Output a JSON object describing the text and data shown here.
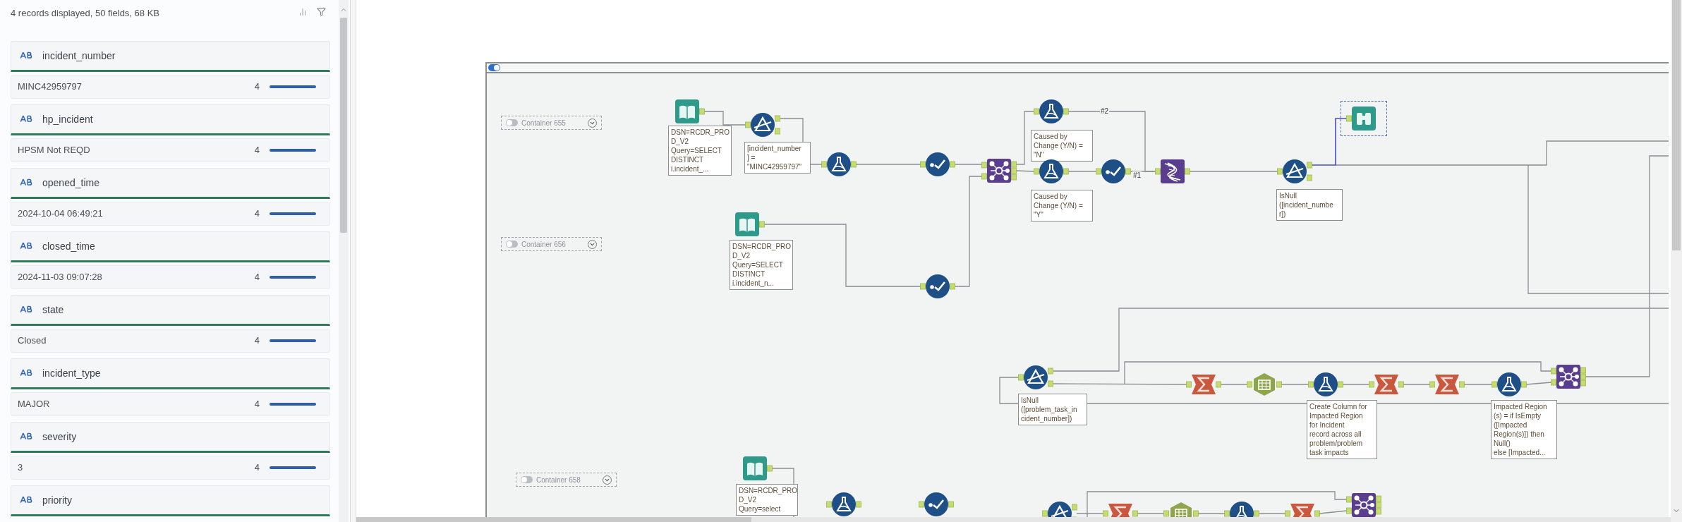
{
  "results_panel": {
    "summary": "4 records displayed, 50 fields, 68 KB",
    "fields": [
      {
        "name": "incident_number",
        "value": "MINC42959797",
        "count": "4",
        "level": 1
      },
      {
        "name": "hp_incident",
        "value": "HPSM Not REQD",
        "count": "4",
        "level": 1
      },
      {
        "name": "opened_time",
        "value": "2024-10-04 06:49:21",
        "count": "4",
        "level": 1
      },
      {
        "name": "closed_time",
        "value": "2024-11-03 09:07:28",
        "count": "4",
        "level": 1
      },
      {
        "name": "state",
        "value": "Closed",
        "count": "4",
        "level": 1
      },
      {
        "name": "incident_type",
        "value": "MAJOR",
        "count": "4",
        "level": 1
      },
      {
        "name": "severity",
        "value": "3",
        "count": "4",
        "level": 1
      },
      {
        "name": "priority"
      }
    ]
  },
  "canvas": {
    "main_container": {
      "on": true
    },
    "containers": [
      {
        "label": "Container 655",
        "on": false
      },
      {
        "label": "Container 656",
        "on": false
      },
      {
        "label": "Container 658",
        "on": false
      }
    ],
    "tools": [
      {
        "kind": "input",
        "selected": false,
        "annotation": [
          "DSN=RCDR_PRO",
          "D_V2",
          "Query=SELECT",
          "DISTINCT",
          "i.incident_..."
        ]
      },
      {
        "kind": "filter",
        "selected": false,
        "annotation": [
          "[incident_number",
          "] =",
          "\"MINC42959797\""
        ]
      },
      {
        "kind": "formula",
        "selected": false
      },
      {
        "kind": "select",
        "selected": false
      },
      {
        "kind": "input",
        "selected": false,
        "annotation": [
          "DSN=RCDR_PRO",
          "D_V2",
          "Query=SELECT",
          "DISTINCT",
          "i.incident_n..."
        ]
      },
      {
        "kind": "select",
        "selected": false
      },
      {
        "kind": "join",
        "selected": false
      },
      {
        "kind": "formula",
        "selected": false,
        "annotation": [
          "Caused by",
          "Change (Y/N) =",
          "\"N\""
        ]
      },
      {
        "kind": "formula",
        "selected": false,
        "annotation": [
          "Caused by",
          "Change (Y/N) =",
          "\"Y\""
        ]
      },
      {
        "kind": "select",
        "selected": false
      },
      {
        "kind": "dna",
        "selected": false
      },
      {
        "kind": "filter",
        "selected": false,
        "annotation": [
          "IsNull",
          "([incident_numbe",
          "r])"
        ]
      },
      {
        "kind": "browse",
        "selected": true
      },
      {
        "kind": "filter",
        "selected": false,
        "annotation": [
          "IsNull",
          "([problem_task_in",
          "cident_number])"
        ]
      },
      {
        "kind": "summarize",
        "selected": false
      },
      {
        "kind": "crosstab",
        "selected": false
      },
      {
        "kind": "formula",
        "selected": false,
        "annotation": [
          "Create Column for",
          "Impacted Region",
          "for Incident",
          "record across all",
          "problem/problem",
          "task impacts"
        ]
      },
      {
        "kind": "summarize",
        "selected": false
      },
      {
        "kind": "summarize",
        "selected": false
      },
      {
        "kind": "formula",
        "selected": false,
        "annotation": [
          "Impacted Region",
          "(s) = if IsEmpty",
          "([Impacted",
          "Region(s)]) then",
          "Null()",
          "else [Impacted..."
        ]
      },
      {
        "kind": "join",
        "selected": false
      },
      {
        "kind": "input",
        "selected": false,
        "annotation": [
          "DSN=RCDR_PRO",
          "D_V2",
          "Query=select"
        ]
      },
      {
        "kind": "formula",
        "selected": false
      },
      {
        "kind": "select",
        "selected": false
      },
      {
        "kind": "filter",
        "selected": false
      },
      {
        "kind": "summarize",
        "selected": false
      },
      {
        "kind": "crosstab",
        "selected": false
      },
      {
        "kind": "formula",
        "selected": false
      },
      {
        "kind": "summarize",
        "selected": false
      },
      {
        "kind": "join",
        "selected": false
      }
    ],
    "connection_labels": [
      "#2",
      "#1"
    ]
  }
}
